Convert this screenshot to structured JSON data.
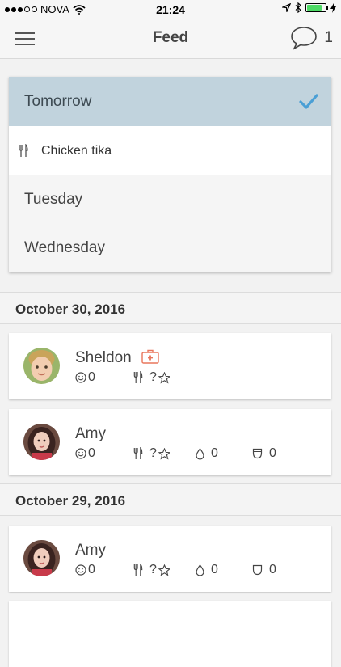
{
  "status_bar": {
    "carrier": "NOVA",
    "time": "21:24"
  },
  "navbar": {
    "title": "Feed",
    "chat_count": "1"
  },
  "dropdown": {
    "selected": "Tomorrow",
    "meal": "Chicken tika",
    "options": [
      "Tuesday",
      "Wednesday"
    ]
  },
  "sections": [
    {
      "date": "October 30, 2016",
      "cards": [
        {
          "name": "Sheldon",
          "mood": "0",
          "meal": "?",
          "water": null,
          "diaper": null
        },
        {
          "name": "Amy",
          "mood": "0",
          "meal": "?",
          "water": "0",
          "diaper": "0"
        }
      ]
    },
    {
      "date": "October 29, 2016",
      "cards": [
        {
          "name": "Amy",
          "mood": "0",
          "meal": "?",
          "water": "0",
          "diaper": "0"
        }
      ]
    }
  ],
  "colors": {
    "selected_bg": "#c1d3dd",
    "check": "#4a9fd5",
    "medical": "#e9765c",
    "battery": "#4cd964"
  },
  "icons": [
    "menu-icon",
    "chat-bubble-icon",
    "checkmark-icon",
    "fork-knife-icon",
    "medical-kit-icon",
    "smiley-icon",
    "star-icon",
    "drop-icon",
    "diaper-icon"
  ]
}
